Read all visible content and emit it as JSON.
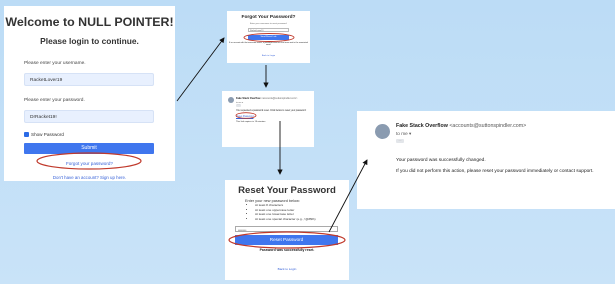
{
  "login": {
    "title": "Welcome to NULL POINTER!",
    "subtitle": "Please login to continue.",
    "username_label": "Please enter your username.",
    "username_value": "RacketLover19",
    "password_label": "Please enter your password.",
    "password_value": "DrRacket19!",
    "show_password_label": "Show Password",
    "submit_label": "Submit",
    "forgot_link": "Forgot your password?",
    "signup_link": "Don't have an account? Sign up here."
  },
  "forgot": {
    "title": "Forgot Your Password?",
    "description": "Enter your username to reset password.",
    "username_value": "RacketLover19",
    "button_label": "Send Reset Link",
    "success_message": "If an account with that username exists, a password reset link has been sent to the associated email.",
    "back_link": "Back to Login"
  },
  "email_reset": {
    "sender_name": "Fake Stack Overflow",
    "sender_address": "<accounts@suttonspindler.com>",
    "to_label": "to me",
    "body": "You requested a password reset. Click below to reset your password:",
    "link_text": "Reset Password",
    "expiry": "This link expires in 15 minutes."
  },
  "reset": {
    "title": "Reset Your Password",
    "instructions": "Enter your new password below:",
    "requirements": [
      "At least 8 characters",
      "At least one uppercase letter",
      "At least one lowercase letter",
      "At least one special character (e.g., !@#$%)"
    ],
    "password_value": "••••••••",
    "button_label": "Reset Password",
    "success_message": "Password was successfully reset.",
    "back_link": "Back to Login"
  },
  "email_changed": {
    "sender_name": "Fake Stack Overflow",
    "sender_address": "<accounts@suttonspindler.com>",
    "to_label": "to me",
    "line1": "Your password was successfully changed.",
    "line2": "If you did not perform this action, please reset your password immediately or contact support."
  },
  "colors": {
    "background": "#bcdcf6",
    "button_blue": "#3f76ee",
    "highlight_red": "#c0392b",
    "link_blue": "#3661d8"
  }
}
